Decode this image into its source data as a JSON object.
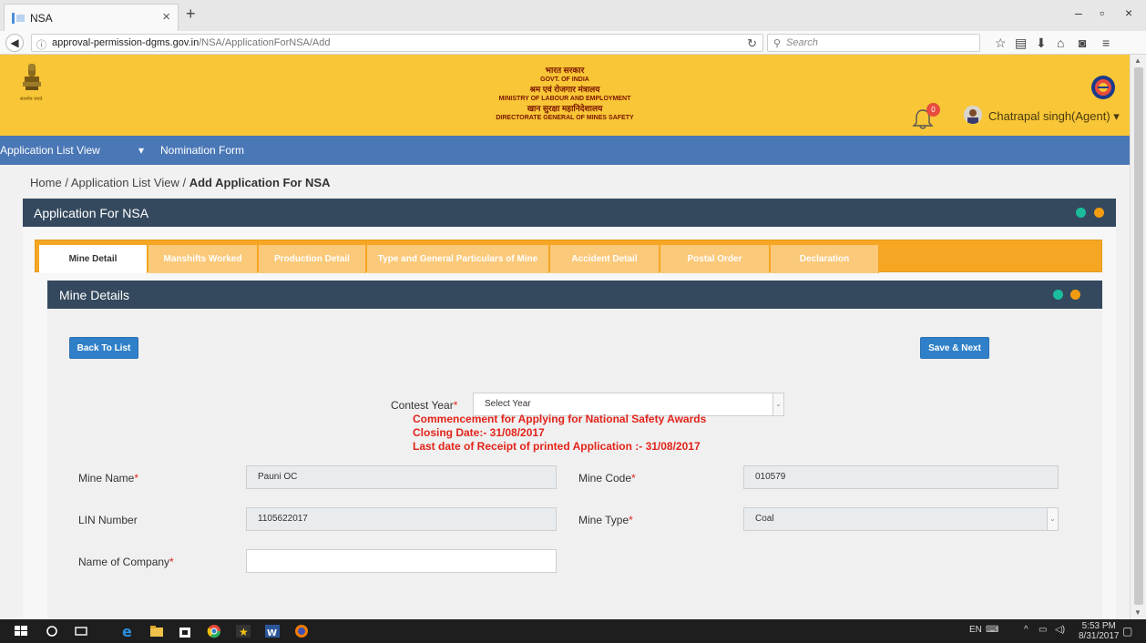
{
  "browser": {
    "tab_title": "NSA",
    "url_host": "approval-permission-dgms.gov.in",
    "url_path": "/NSA/ApplicationForNSA/Add",
    "search_placeholder": "Search"
  },
  "header": {
    "org_lines": [
      "भारत सरकार",
      "GOVT. OF INDIA",
      "श्रम एवं रोजगार मंत्रालय",
      "MINISTRY OF LABOUR AND EMPLOYMENT",
      "खान सुरक्षा महानिदेशालय",
      "DIRECTORATE GENERAL OF MINES SAFETY"
    ],
    "emblem_caption": "सत्यमेव जयते",
    "notification_count": "0",
    "user_name": "Chatrapal singh(Agent) ▾"
  },
  "menu": {
    "item1": "Application List View",
    "caret": "▾",
    "item2": "Nomination Form"
  },
  "breadcrumb": {
    "home": "Home",
    "sep": "/",
    "list": "Application List View",
    "current": "Add Application For NSA"
  },
  "panel": {
    "title": "Application For NSA"
  },
  "tabs": [
    "Mine Detail",
    "Manshifts Worked",
    "Production Detail",
    "Type and General Particulars of Mine",
    "Accident Detail",
    "Postal Order",
    "Declaration"
  ],
  "subpanel": {
    "title": "Mine Details",
    "back_label": "Back To List",
    "save_label": "Save & Next"
  },
  "form": {
    "contest_year_label": "Contest Year",
    "contest_year_value": "Select Year",
    "notice_line1": "Commencement for Applying for National Safety Awards",
    "notice_line2": "Closing Date:- 31/08/2017",
    "notice_line3": "Last date of Receipt of printed Application :- 31/08/2017",
    "mine_name_label": "Mine Name",
    "mine_name_value": "Pauni OC",
    "mine_code_label": "Mine Code",
    "mine_code_value": "010579",
    "lin_label": "LIN Number",
    "lin_value": "1105622017",
    "mine_type_label": "Mine Type",
    "mine_type_value": "Coal",
    "company_label": "Name of Company",
    "company_value": "",
    "required_mark": "*"
  },
  "taskbar": {
    "lang": "EN",
    "time": "5:53 PM",
    "date": "8/31/2017"
  },
  "colors": {
    "header_yellow": "#f8c636",
    "menu_blue": "#4a77b6",
    "panel_navy": "#34495e",
    "tab_orange": "#f5a623",
    "button_blue": "#2f80c8",
    "notice_red": "#e2231a"
  }
}
